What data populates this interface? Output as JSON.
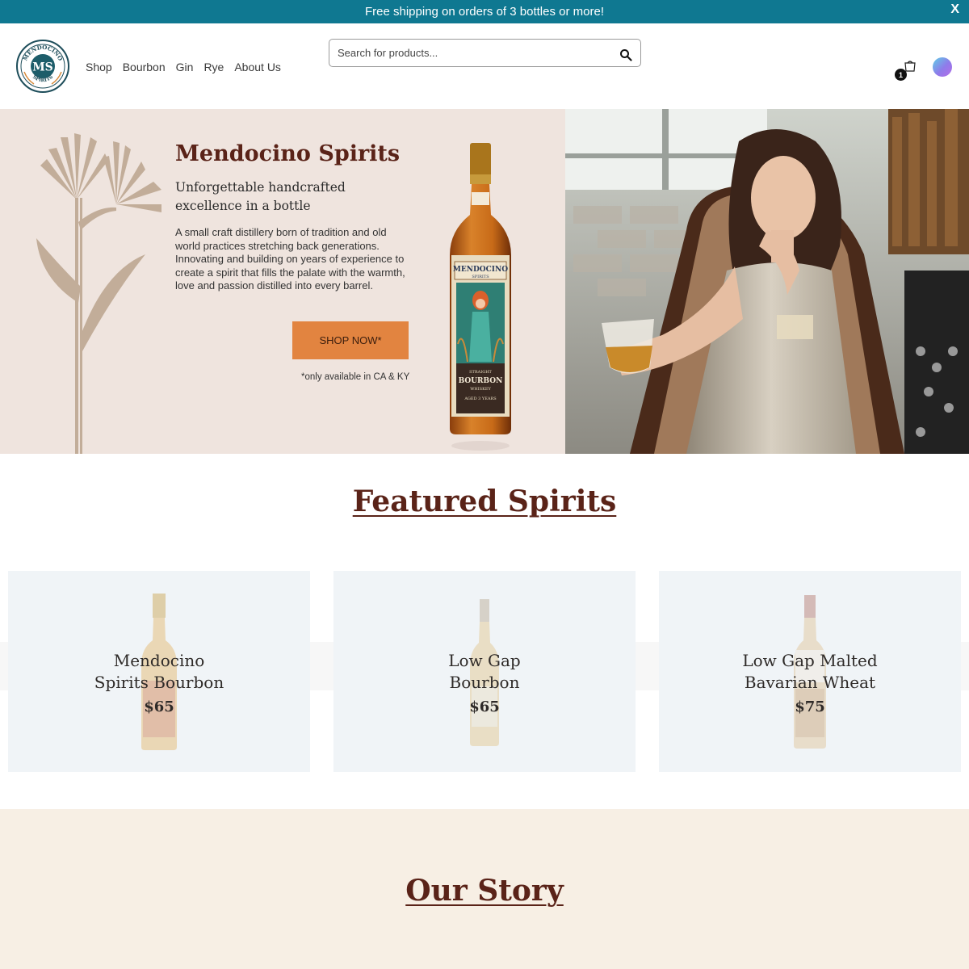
{
  "announcement": {
    "text": "Free shipping on orders of 3 bottles or more!",
    "close_label": "X"
  },
  "logo": {
    "initials": "MS",
    "top_text": "MENDOCINO",
    "bottom_text": "SPIRITS"
  },
  "nav": {
    "items": [
      {
        "label": "Shop"
      },
      {
        "label": "Bourbon"
      },
      {
        "label": "Gin"
      },
      {
        "label": "Rye"
      },
      {
        "label": "About Us"
      }
    ]
  },
  "search": {
    "placeholder": "Search for products..."
  },
  "cart": {
    "count": "1"
  },
  "hero": {
    "title": "Mendocino Spirits",
    "subtitle": "Unforgettable handcrafted excellence in a bottle",
    "description": "A small craft distillery born of tradition and old world practices stretching back generations. Innovating and building on years of experience to create a spirit that fills the palate with the warmth, love and passion distilled into every barrel.",
    "cta_label": "SHOP NOW*",
    "cta_note": "*only available in CA & KY",
    "bottle_label": {
      "brand": "MENDOCINO",
      "brand_sub": "SPIRITS",
      "line1": "STRAIGHT",
      "line2": "BOURBON",
      "line3": "WHISKEY",
      "line4": "AGED 3 YEARS"
    }
  },
  "featured": {
    "title": "Featured Spirits",
    "products": [
      {
        "name_line1": "Mendocino",
        "name_line2": "Spirits Bourbon",
        "price": "$65"
      },
      {
        "name_line1": "Low Gap",
        "name_line2": "Bourbon",
        "price": "$65"
      },
      {
        "name_line1": "Low Gap Malted",
        "name_line2": "Bavarian Wheat",
        "price": "$75"
      }
    ]
  },
  "story": {
    "title": "Our Story"
  },
  "colors": {
    "announcement_bg": "#0f7891",
    "brand_brown": "#5a2318",
    "cta_orange": "#e28440",
    "hero_bg": "#efe4de",
    "card_bg": "#f0f4f7",
    "story_bg": "#f7efe4"
  },
  "icons": [
    "search-icon",
    "cart-icon",
    "close-icon",
    "avatar"
  ]
}
